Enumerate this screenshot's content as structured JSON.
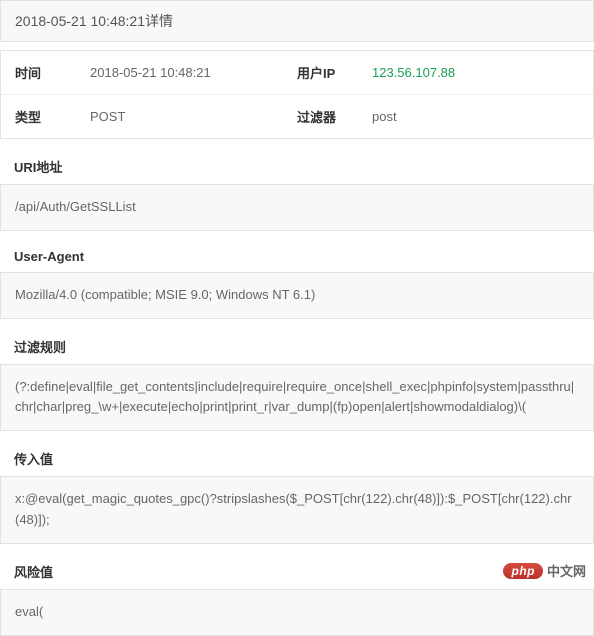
{
  "header": {
    "title": "2018-05-21 10:48:21详情"
  },
  "info": {
    "time_label": "时间",
    "time_value": "2018-05-21 10:48:21",
    "ip_label": "用户IP",
    "ip_value": "123.56.107.88",
    "type_label": "类型",
    "type_value": "POST",
    "filter_label": "过滤器",
    "filter_value": "post"
  },
  "sections": {
    "uri_label": "URI地址",
    "uri_value": "/api/Auth/GetSSLList",
    "ua_label": "User-Agent",
    "ua_value": "Mozilla/4.0 (compatible; MSIE 9.0; Windows NT 6.1)",
    "rule_label": "过滤规则",
    "rule_value": "(?:define|eval|file_get_contents|include|require|require_once|shell_exec|phpinfo|system|passthru|chr|char|preg_\\w+|execute|echo|print|print_r|var_dump|(fp)open|alert|showmodaldialog)\\(",
    "input_label": "传入值",
    "input_value": "x:@eval(get_magic_quotes_gpc()?stripslashes($_POST[chr(122).chr(48)]):$_POST[chr(122).chr(48)]);",
    "risk_label": "风险值",
    "risk_value": "eval("
  },
  "watermark": {
    "badge": "php",
    "text": "中文网"
  }
}
